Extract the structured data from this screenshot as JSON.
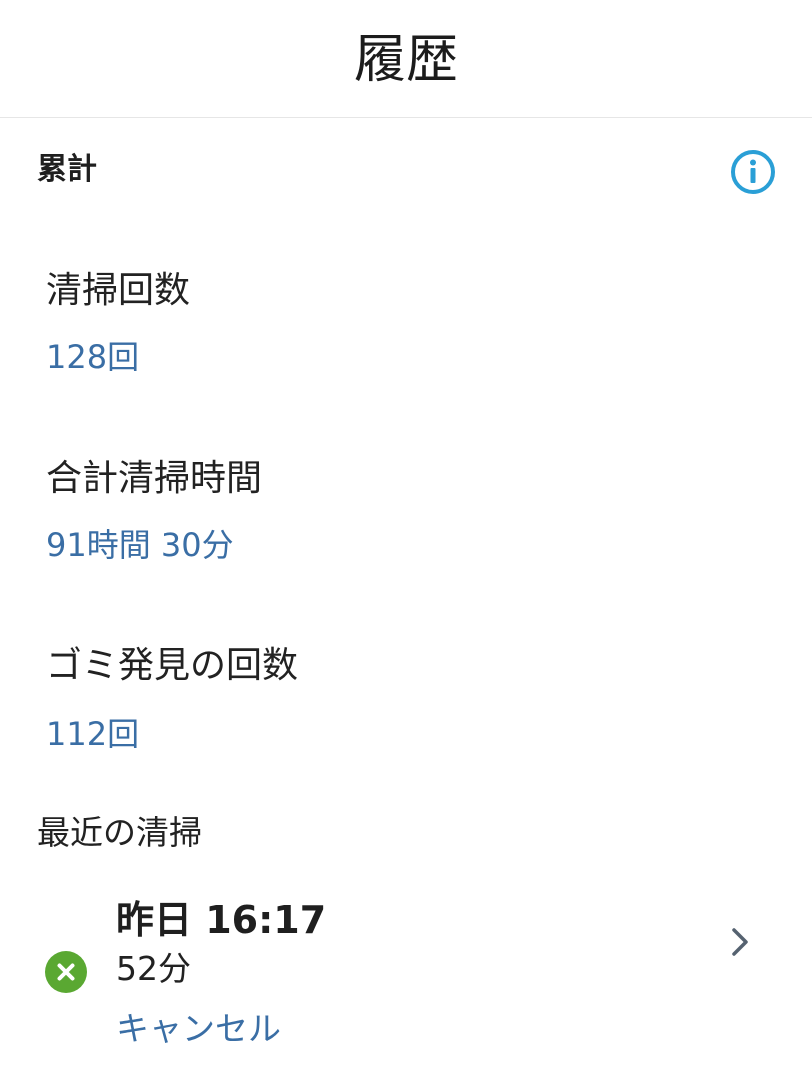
{
  "header": {
    "title": "履歴"
  },
  "totals": {
    "title": "累計",
    "info_icon": "info-circle-icon",
    "stats": [
      {
        "label": "清掃回数",
        "value": "128回"
      },
      {
        "label": "合計清掃時間",
        "value": "91時間 30分"
      },
      {
        "label": "ゴミ発見の回数",
        "value": "112回"
      }
    ]
  },
  "recent": {
    "title": "最近の清掃",
    "items": [
      {
        "time": "昨日 16:17",
        "duration": "52分",
        "status": "キャンセル",
        "status_icon": "x-circle-icon",
        "status_icon_color": "#5aa832"
      }
    ]
  },
  "colors": {
    "accent_blue": "#3a6ea5",
    "info_icon": "#2a9fd6"
  }
}
